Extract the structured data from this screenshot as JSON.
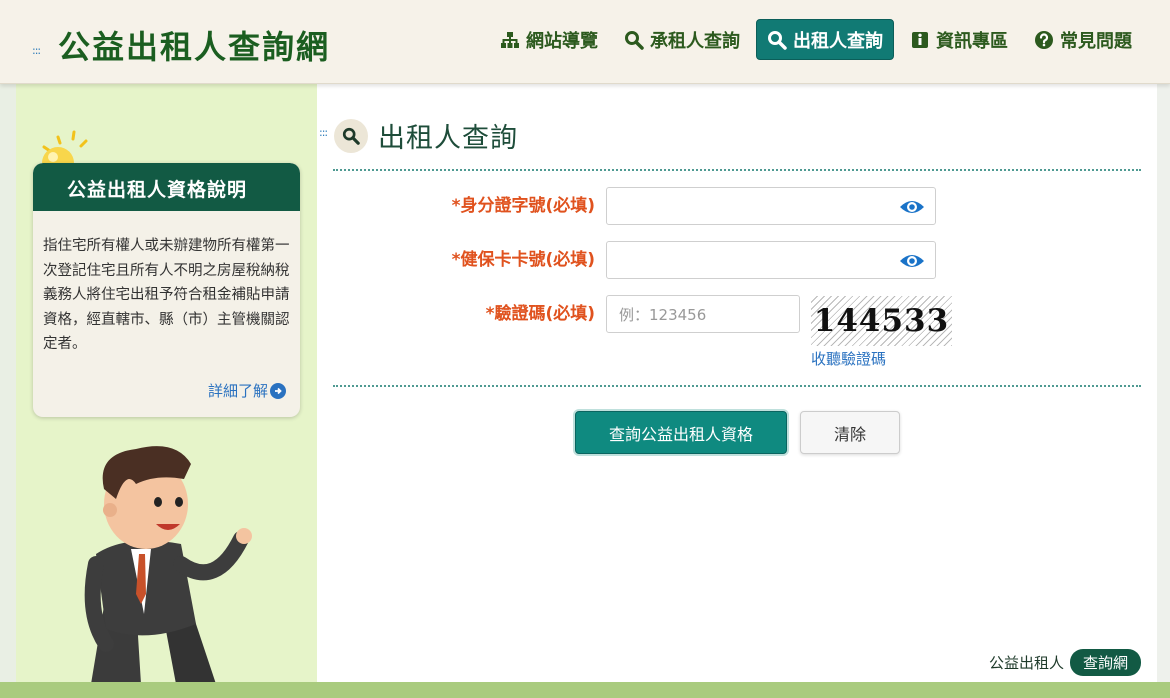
{
  "header": {
    "accesskey": ":::",
    "site_title": "公益出租人查詢網",
    "nav": [
      {
        "label": "網站導覽",
        "icon": "sitemap-icon"
      },
      {
        "label": "承租人查詢",
        "icon": "search-icon"
      },
      {
        "label": "出租人查詢",
        "icon": "search-icon",
        "active": true
      },
      {
        "label": "資訊專區",
        "icon": "info-icon"
      },
      {
        "label": "常見問題",
        "icon": "question-icon"
      }
    ]
  },
  "sidebar": {
    "card_title": "公益出租人資格說明",
    "card_body": "指住宅所有權人或未辦建物所有權第一次登記住宅且所有人不明之房屋稅納稅義務人將住宅出租予符合租金補貼申請資格，經直轄市、縣（市）主管機關認定者。",
    "more_label": "詳細了解"
  },
  "main": {
    "accesskey": ":::",
    "page_title": "出租人查詢",
    "form": {
      "id_label": "*身分證字號(必填)",
      "id_value": "",
      "nhi_label": "*健保卡卡號(必填)",
      "nhi_value": "",
      "captcha_label": "*驗證碼(必填)",
      "captcha_placeholder": "例：123456",
      "captcha_text": "144533",
      "listen_label": "收聽驗證碼"
    },
    "buttons": {
      "submit_label": "查詢公益出租人資格",
      "clear_label": "清除"
    },
    "footer": {
      "brand_text": "公益出租人",
      "brand_pill": "查詢網"
    }
  },
  "colors": {
    "brand_green": "#1b5e20",
    "teal": "#117a74",
    "required_orange": "#e0521e",
    "link_blue": "#2a72c0"
  }
}
